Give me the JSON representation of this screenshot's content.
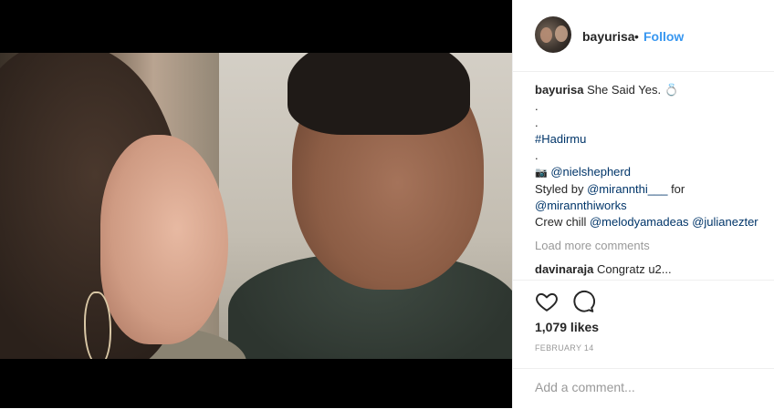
{
  "post": {
    "username": "bayurisa",
    "separator": "•",
    "follow_label": "Follow"
  },
  "caption": {
    "username": "bayurisa",
    "text": "She Said Yes.",
    "ring_glyph": "💍",
    "dot1": ".",
    "dot2": ".",
    "hashtag": "#Hadirmu",
    "dot3": ".",
    "camera_glyph": "📷",
    "photographer": "@nielshepherd",
    "styled_prefix": "Styled by ",
    "stylist": "@mirannthi___",
    "for_text": " for",
    "works": "@mirannthiworks",
    "crew_prefix": "Crew chill ",
    "crew1": "@melodyamadeas",
    "crew2": "@julianezter"
  },
  "comments": {
    "load_more": "Load more comments",
    "items": [
      {
        "username": "davinaraja",
        "text": "Congratz u2..."
      }
    ]
  },
  "stats": {
    "likes": "1,079 likes",
    "date": "FEBRUARY 14"
  },
  "add_comment": {
    "placeholder": "Add a comment..."
  },
  "colors": {
    "link": "#003569",
    "follow": "#3897f0",
    "muted": "#999999"
  },
  "icons": [
    "heart-icon",
    "comment-icon",
    "ring-icon",
    "camera-icon"
  ]
}
